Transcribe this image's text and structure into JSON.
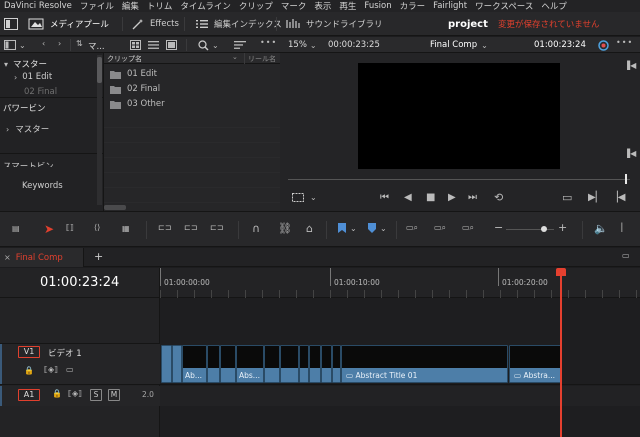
{
  "menu": {
    "items": [
      "DaVinci Resolve",
      "ファイル",
      "編集",
      "トリム",
      "タイムライン",
      "クリップ",
      "マーク",
      "表示",
      "再生",
      "Fusion",
      "カラー",
      "Fairlight",
      "ワークスペース",
      "ヘルプ"
    ]
  },
  "toolbar": {
    "media_pool": "メディアプール",
    "effects": "Effects",
    "edit_index": "編集インデックス",
    "sound_library": "サウンドライブラリ",
    "project_name": "project",
    "unsaved": "変更が保存されていません"
  },
  "media_pool": {
    "header_label": "マ...",
    "col_clip_name": "クリップ名",
    "col_reel_name": "リール名",
    "master_label": "マスター",
    "bins": [
      "01 Edit",
      "02 Final"
    ],
    "power_bins_label": "パワービン",
    "power_master_label": "マスター",
    "smart_bins_label": "スマートビン",
    "keywords_label": "Keywords",
    "clips": [
      "01 Edit",
      "02 Final",
      "03 Other"
    ]
  },
  "viewer": {
    "zoom": "15%",
    "source_tc": "00:00:23:25",
    "timeline_name": "Final Comp",
    "record_tc": "01:00:23:24"
  },
  "timeline": {
    "tab_name": "Final Comp",
    "add_tab": "+",
    "current_tc": "01:00:23:24",
    "ruler": [
      "01:00:00:00",
      "01:00:10:00",
      "01:00:20:00"
    ],
    "v1_label": "V1",
    "v1_name": "ビデオ 1",
    "a1_label": "A1",
    "a1_s": "S",
    "a1_m": "M",
    "a1_level": "2.0",
    "clips": [
      "Ab...",
      "Abs...",
      "Abs...",
      "Abstract Title 01",
      "Abstra..."
    ]
  },
  "colors": {
    "accent_red": "#e0402e",
    "clip_blue": "#4d7ea8",
    "playhead": "#e5402f"
  }
}
